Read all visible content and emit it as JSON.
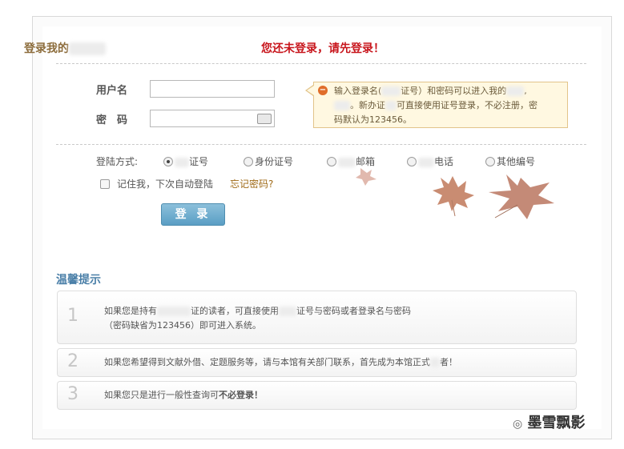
{
  "header": {
    "title": "登录我的",
    "notice": "您还未登录，请先登录！"
  },
  "form": {
    "username_label": "用户名",
    "password_label": "密　码"
  },
  "tip": {
    "text_line1a": "输入登录名(",
    "text_line1b": "证号）和密码可以进入我的",
    "text_line2a": "。新办证",
    "text_line2b": "可直接使用证号登录，不必注册，密",
    "text_line3": "码默认为123456。"
  },
  "login_method": {
    "label": "登陆方式:",
    "options": [
      "证号",
      "身份证号",
      "邮箱",
      "电话",
      "其他编号"
    ],
    "selected": 0
  },
  "remember": {
    "label": "记住我，下次自动登陆",
    "forgot_link": "忘记密码?"
  },
  "login_button": "登 录",
  "hints": {
    "title": "温馨提示",
    "items": [
      {
        "num": "1",
        "line1a": "如果您是持有",
        "line1b": "证的读者，可直接使用",
        "line1c": "证号与密码或者登录名与密码",
        "line2": "（密码缺省为123456）即可进入系统。"
      },
      {
        "num": "2",
        "line1a": "如果您希望得到文献外借、定题服务等，请与本馆有关部门联系，首先成为本馆正式",
        "line1b": "者！"
      },
      {
        "num": "3",
        "line1a": "如果您只是进行一般性查询可",
        "line1b": "不必登录！"
      }
    ]
  },
  "watermark": "墨雪飘影",
  "colors": {
    "notice": "#c8161d",
    "title": "#8c6c3b",
    "hint_title": "#4a7fa8",
    "button": "#5a9ec4"
  }
}
